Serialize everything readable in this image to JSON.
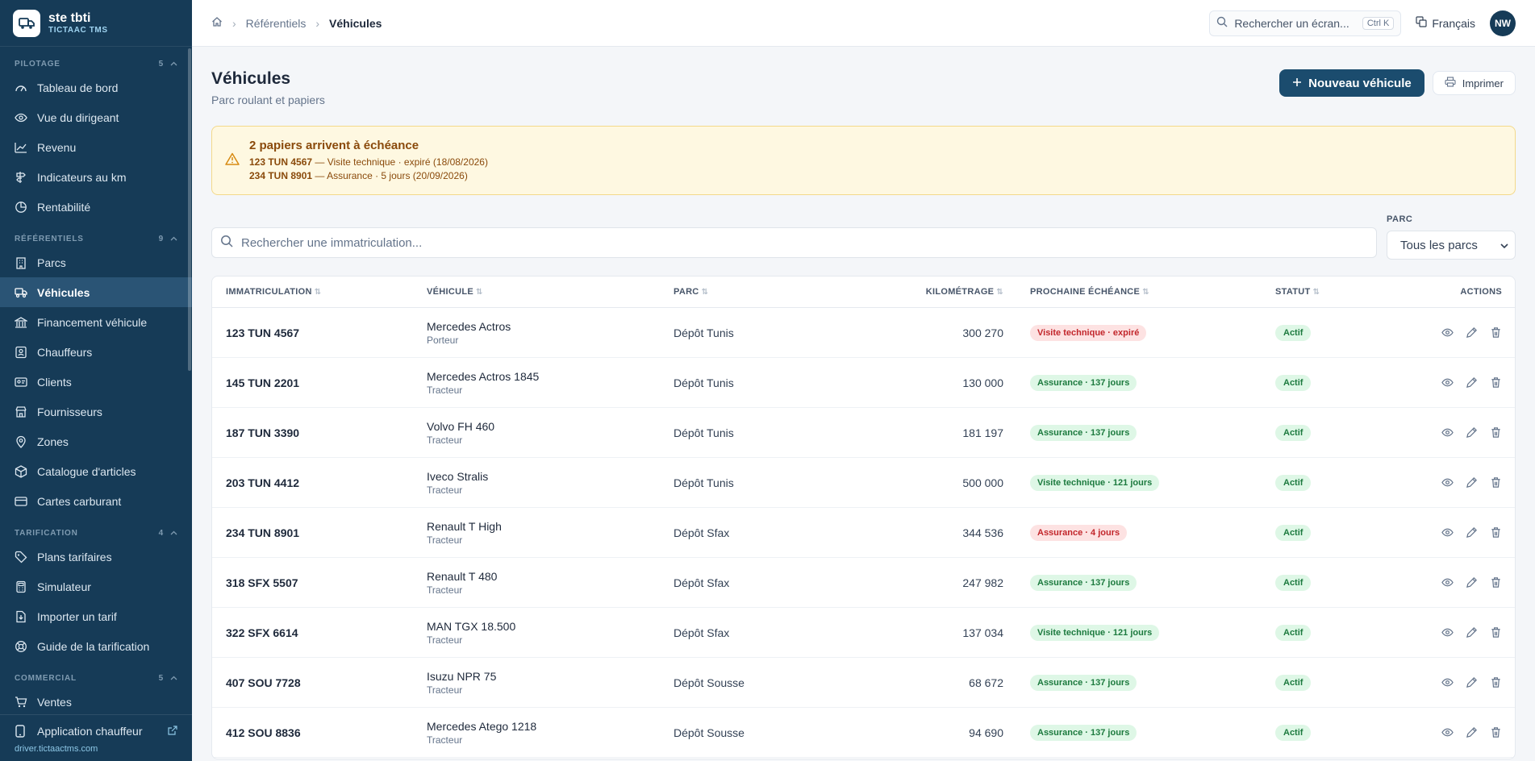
{
  "brand": {
    "name": "ste tbti",
    "product": "TICTAAC TMS"
  },
  "sidebar": {
    "sections": [
      {
        "label": "PILOTAGE",
        "count": "5",
        "items": [
          {
            "label": "Tableau de bord",
            "icon": "gauge-icon"
          },
          {
            "label": "Vue du dirigeant",
            "icon": "eye-icon"
          },
          {
            "label": "Revenu",
            "icon": "trend-icon"
          },
          {
            "label": "Indicateurs au km",
            "icon": "signpost-icon"
          },
          {
            "label": "Rentabilité",
            "icon": "pie-icon"
          }
        ]
      },
      {
        "label": "RÉFÉRENTIELS",
        "count": "9",
        "items": [
          {
            "label": "Parcs",
            "icon": "building-icon"
          },
          {
            "label": "Véhicules",
            "icon": "truck-icon",
            "active": true
          },
          {
            "label": "Financement véhicule",
            "icon": "bank-icon"
          },
          {
            "label": "Chauffeurs",
            "icon": "id-card-icon"
          },
          {
            "label": "Clients",
            "icon": "contact-icon"
          },
          {
            "label": "Fournisseurs",
            "icon": "store-icon"
          },
          {
            "label": "Zones",
            "icon": "map-pin-icon"
          },
          {
            "label": "Catalogue d'articles",
            "icon": "box-icon"
          },
          {
            "label": "Cartes carburant",
            "icon": "card-icon"
          }
        ]
      },
      {
        "label": "TARIFICATION",
        "count": "4",
        "items": [
          {
            "label": "Plans tarifaires",
            "icon": "tag-icon"
          },
          {
            "label": "Simulateur",
            "icon": "calculator-icon"
          },
          {
            "label": "Importer un tarif",
            "icon": "file-import-icon"
          },
          {
            "label": "Guide de la tarification",
            "icon": "lifebuoy-icon"
          }
        ]
      },
      {
        "label": "COMMERCIAL",
        "count": "5",
        "items": [
          {
            "label": "Ventes",
            "icon": "cart-icon"
          }
        ]
      }
    ],
    "footer": {
      "label": "Application chauffeur",
      "url": "driver.tictaactms.com"
    }
  },
  "topbar": {
    "breadcrumb": [
      "Référentiels",
      "Véhicules"
    ],
    "search_placeholder": "Rechercher un écran...",
    "shortcut": "Ctrl K",
    "language": "Français",
    "avatar": "NW"
  },
  "page": {
    "title": "Véhicules",
    "subtitle": "Parc roulant et papiers",
    "new_button": "Nouveau véhicule",
    "print_button": "Imprimer"
  },
  "alert": {
    "title": "2 papiers arrivent à échéance",
    "lines": [
      {
        "plate": "123 TUN 4567",
        "text": "— Visite technique · expiré (18/08/2026)"
      },
      {
        "plate": "234 TUN 8901",
        "text": "— Assurance · 5 jours (20/09/2026)"
      }
    ]
  },
  "filters": {
    "search_placeholder": "Rechercher une immatriculation...",
    "parc_label": "PARC",
    "parc_value": "Tous les parcs"
  },
  "table": {
    "columns": [
      "IMMATRICULATION",
      "VÉHICULE",
      "PARC",
      "KILOMÉTRAGE",
      "PROCHAINE ÉCHÉANCE",
      "STATUT",
      "ACTIONS"
    ],
    "rows": [
      {
        "plate": "123 TUN 4567",
        "vehicle": "Mercedes Actros",
        "type": "Porteur",
        "parc": "Dépôt Tunis",
        "km": "300 270",
        "deadline": "Visite technique · expiré",
        "deadline_level": "bad",
        "status": "Actif"
      },
      {
        "plate": "145 TUN 2201",
        "vehicle": "Mercedes Actros 1845",
        "type": "Tracteur",
        "parc": "Dépôt Tunis",
        "km": "130 000",
        "deadline": "Assurance · 137 jours",
        "deadline_level": "ok",
        "status": "Actif"
      },
      {
        "plate": "187 TUN 3390",
        "vehicle": "Volvo FH 460",
        "type": "Tracteur",
        "parc": "Dépôt Tunis",
        "km": "181 197",
        "deadline": "Assurance · 137 jours",
        "deadline_level": "ok",
        "status": "Actif"
      },
      {
        "plate": "203 TUN 4412",
        "vehicle": "Iveco Stralis",
        "type": "Tracteur",
        "parc": "Dépôt Tunis",
        "km": "500 000",
        "deadline": "Visite technique · 121 jours",
        "deadline_level": "ok",
        "status": "Actif"
      },
      {
        "plate": "234 TUN 8901",
        "vehicle": "Renault T High",
        "type": "Tracteur",
        "parc": "Dépôt Sfax",
        "km": "344 536",
        "deadline": "Assurance · 4 jours",
        "deadline_level": "bad",
        "status": "Actif"
      },
      {
        "plate": "318 SFX 5507",
        "vehicle": "Renault T 480",
        "type": "Tracteur",
        "parc": "Dépôt Sfax",
        "km": "247 982",
        "deadline": "Assurance · 137 jours",
        "deadline_level": "ok",
        "status": "Actif"
      },
      {
        "plate": "322 SFX 6614",
        "vehicle": "MAN TGX 18.500",
        "type": "Tracteur",
        "parc": "Dépôt Sfax",
        "km": "137 034",
        "deadline": "Visite technique · 121 jours",
        "deadline_level": "ok",
        "status": "Actif"
      },
      {
        "plate": "407 SOU 7728",
        "vehicle": "Isuzu NPR 75",
        "type": "Tracteur",
        "parc": "Dépôt Sousse",
        "km": "68 672",
        "deadline": "Assurance · 137 jours",
        "deadline_level": "ok",
        "status": "Actif"
      },
      {
        "plate": "412 SOU 8836",
        "vehicle": "Mercedes Atego 1218",
        "type": "Tracteur",
        "parc": "Dépôt Sousse",
        "km": "94 690",
        "deadline": "Assurance · 137 jours",
        "deadline_level": "ok",
        "status": "Actif"
      }
    ]
  },
  "colors": {
    "sidebar": "#163b57",
    "primary": "#1b4c6e",
    "ok": "#1c7a3e",
    "bad": "#c2262b"
  }
}
